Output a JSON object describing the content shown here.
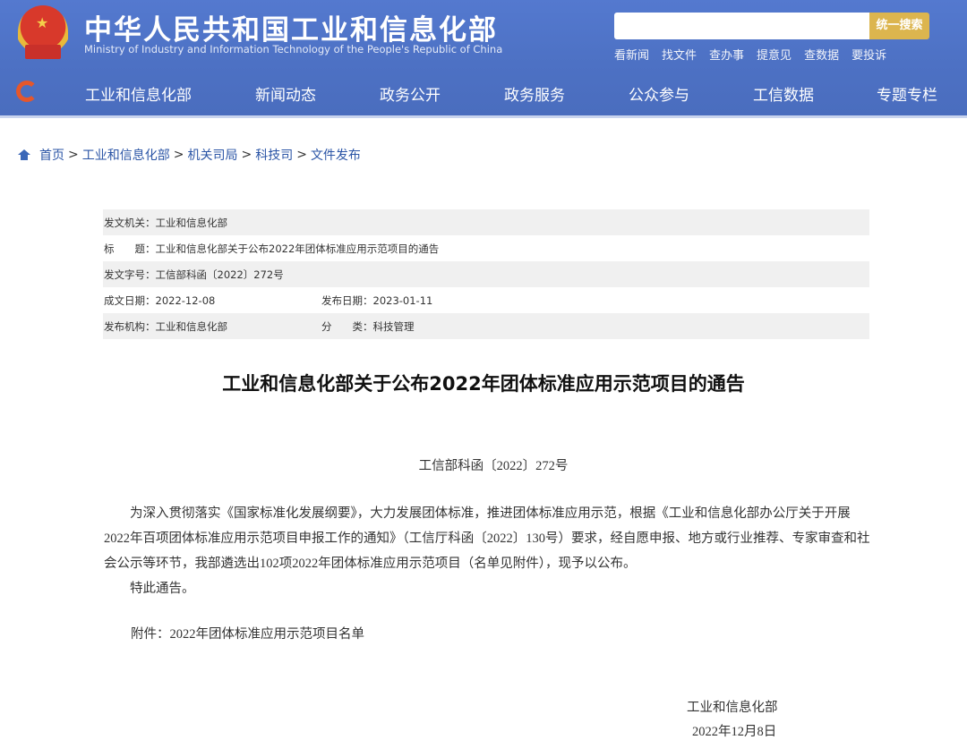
{
  "header": {
    "title": "中华人民共和国工业和信息化部",
    "subtitle": "Ministry of Industry and Information Technology of the People's Republic of China",
    "search_placeholder": "",
    "search_button": "统一搜索",
    "quick_links": [
      "看新闻",
      "找文件",
      "查办事",
      "提意见",
      "查数据",
      "要投诉"
    ],
    "nav": [
      "工业和信息化部",
      "新闻动态",
      "政务公开",
      "政务服务",
      "公众参与",
      "工信数据",
      "专题专栏"
    ]
  },
  "breadcrumb": [
    "首页",
    "工业和信息化部",
    "机关司局",
    "科技司",
    "文件发布"
  ],
  "meta": {
    "issuer_label": "发文机关：",
    "issuer": "工业和信息化部",
    "title_label": "标　　题：",
    "title": "工业和信息化部关于公布2022年团体标准应用示范项目的通告",
    "docno_label": "发文字号：",
    "docno": "工信部科函〔2022〕272号",
    "created_label": "成文日期：",
    "created": "2022-12-08",
    "published_label": "发布日期：",
    "published": "2023-01-11",
    "org_label": "发布机构：",
    "org": "工业和信息化部",
    "category_label": "分　　类：",
    "category": "科技管理"
  },
  "document": {
    "title": "工业和信息化部关于公布2022年团体标准应用示范项目的通告",
    "number": "工信部科函〔2022〕272号",
    "paragraph": "为深入贯彻落实《国家标准化发展纲要》，大力发展团体标准，推进团体标准应用示范，根据《工业和信息化部办公厅关于开展2022年百项团体标准应用示范项目申报工作的通知》（工信厅科函〔2022〕130号）要求，经自愿申报、地方或行业推荐、专家审查和社会公示等环节，我部遴选出102项2022年团体标准应用示范项目（名单见附件），现予以公布。",
    "closing": "特此通告。",
    "attachment": "附件：2022年团体标准应用示范项目名单",
    "signature": "工业和信息化部",
    "date": "2022年12月8日"
  }
}
